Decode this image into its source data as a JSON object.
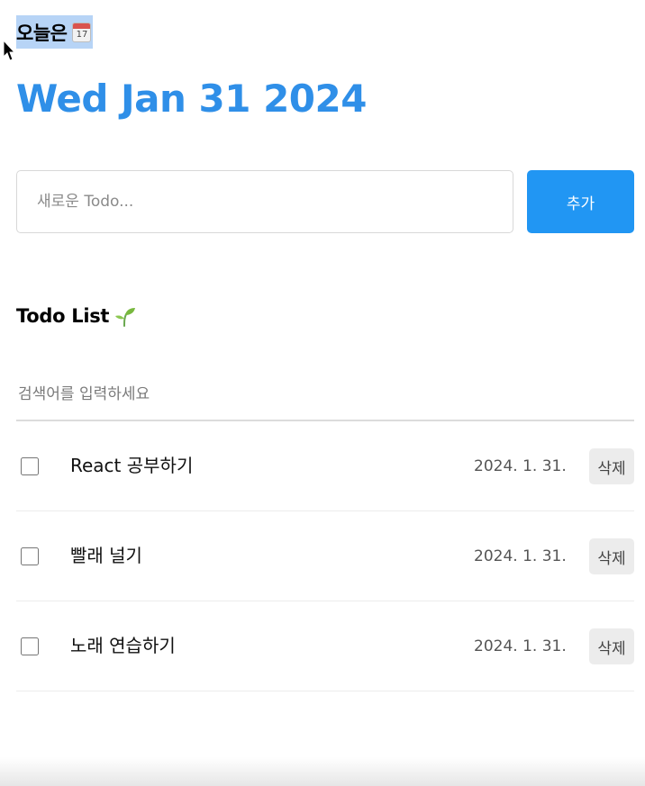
{
  "header": {
    "greeting": "오늘은",
    "calendar_icon": "calendar-icon",
    "calendar_day": "17",
    "date": "Wed Jan 31 2024"
  },
  "editor": {
    "placeholder": "새로운 Todo...",
    "value": "",
    "add_label": "추가"
  },
  "list": {
    "title": "Todo List",
    "title_icon": "sprout-icon",
    "search_placeholder": "검색어를 입력하세요",
    "items": [
      {
        "checked": false,
        "content": "React 공부하기",
        "date": "2024. 1. 31.",
        "delete_label": "삭제"
      },
      {
        "checked": false,
        "content": "빨래 널기",
        "date": "2024. 1. 31.",
        "delete_label": "삭제"
      },
      {
        "checked": false,
        "content": "노래 연습하기",
        "date": "2024. 1. 31.",
        "delete_label": "삭제"
      }
    ]
  },
  "colors": {
    "accent": "#2196f3",
    "date_title": "#2f8fe8",
    "selection_highlight": "#b7d4f6",
    "delete_bg": "#ececec"
  }
}
